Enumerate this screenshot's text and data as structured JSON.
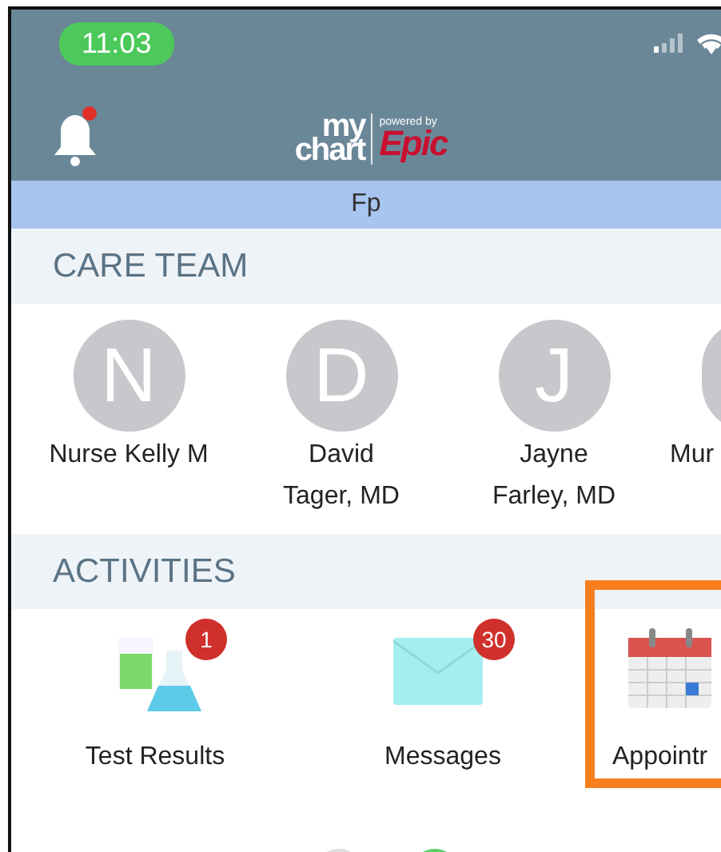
{
  "status_bar": {
    "time": "11:03"
  },
  "header": {
    "notifications": {
      "unread": true
    },
    "logo": {
      "top": "my",
      "bottom": "chart",
      "tagline": "powered by",
      "brand": "Epic"
    }
  },
  "patient_bar": {
    "name": "Fp"
  },
  "care_team": {
    "title": "CARE TEAM",
    "members": [
      {
        "kind": "full",
        "initial": "N",
        "name": "Nurse Kelly M"
      },
      {
        "kind": "full",
        "initial": "D",
        "name": "David\nTager, MD"
      },
      {
        "kind": "full",
        "initial": "J",
        "name": "Jayne\nFarley, MD"
      },
      {
        "kind": "partial",
        "name": "Mur"
      }
    ]
  },
  "activities": {
    "title": "ACTIVITIES",
    "items": [
      {
        "kind": "test-results",
        "label": "Test Results",
        "badge": "1",
        "highlighted": false
      },
      {
        "kind": "messages",
        "label": "Messages",
        "badge": "30",
        "highlighted": false
      },
      {
        "kind": "appointments",
        "label": "Appointr",
        "highlighted": true
      }
    ]
  }
}
